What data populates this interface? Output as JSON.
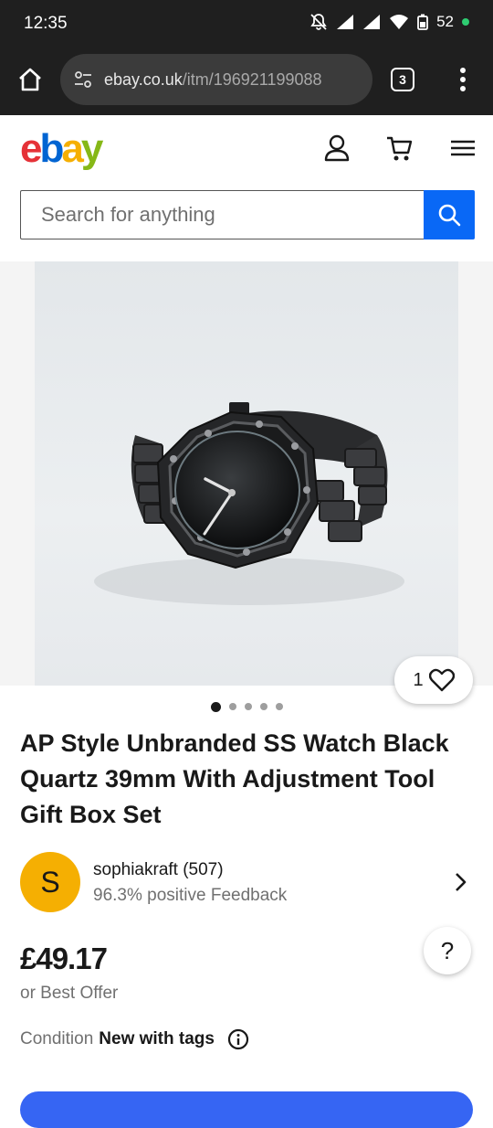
{
  "status_bar": {
    "time": "12:35",
    "battery": "52"
  },
  "browser": {
    "url_domain": "ebay.co.uk",
    "url_path": "/itm/196921199088",
    "tab_count": "3"
  },
  "header": {
    "logo_text": "ebay",
    "search_placeholder": "Search for anything"
  },
  "gallery": {
    "like_count": "1",
    "image_count": 5,
    "active_index": 0
  },
  "product": {
    "title": "AP Style Unbranded SS Watch Black Quartz 39mm With Adjustment Tool Gift Box Set",
    "price": "£49.17",
    "best_offer": "or Best Offer",
    "condition_label": "Condition",
    "condition_value": "New with tags"
  },
  "seller": {
    "initial": "S",
    "name": "sophiakraft (507)",
    "feedback": "96.3% positive Feedback"
  },
  "help_label": "?",
  "colors": {
    "ebay_blue": "#0968f6",
    "cta_blue": "#3665f3",
    "avatar_yellow": "#f5af02"
  }
}
